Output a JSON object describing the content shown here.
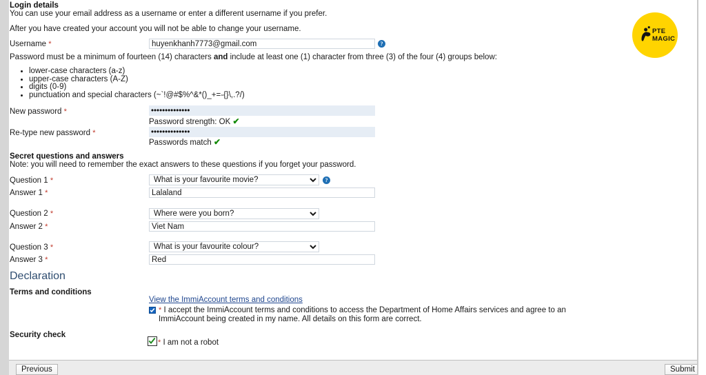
{
  "login_section": {
    "heading": "Login details",
    "intro_line1": "You can use your email address as a username or enter a different username if you prefer.",
    "intro_line2": "After you have created your account you will not be able to change your username.",
    "username_label": "Username",
    "username_value": "huyenkhanh7773@gmail.com",
    "username_help_icon": "help-icon",
    "password_rule_intro_a": "Password must be a minimum of fourteen (14) characters ",
    "password_rule_intro_bold": "and",
    "password_rule_intro_b": " include at least one (1) character from three (3) of the four (4) groups below:",
    "password_rules": [
      "lower-case characters (a-z)",
      "upper-case characters (A-Z)",
      "digits (0-9)",
      "punctuation and special characters (~`!@#$%^&*()_+=-{}\\,.?/)"
    ],
    "new_password_label": "New password",
    "new_password_value": "••••••••••••••",
    "password_strength_text": "Password strength: OK",
    "retype_password_label": "Re-type new password",
    "retype_password_value": "••••••••••••••",
    "passwords_match_text": "Passwords match",
    "tick_glyph": "✔"
  },
  "secret_section": {
    "heading": "Secret questions and answers",
    "note": "Note: you will need to remember the exact answers to these questions if you forget your password.",
    "help_icon": "help-icon",
    "items": [
      {
        "question_label": "Question 1",
        "question_value": "What is your favourite movie?",
        "answer_label": "Answer 1",
        "answer_value": "Lalaland"
      },
      {
        "question_label": "Question 2",
        "question_value": "Where were you born?",
        "answer_label": "Answer 2",
        "answer_value": "Viet Nam"
      },
      {
        "question_label": "Question 3",
        "question_value": "What is your favourite colour?",
        "answer_label": "Answer 3",
        "answer_value": "Red"
      }
    ]
  },
  "declaration_section": {
    "heading": "Declaration",
    "terms_label": "Terms and conditions",
    "terms_link": "View the ImmiAccount terms and conditions",
    "accept_text": "I accept the ImmiAccount terms and conditions to access the Department of Home Affairs services and agree to an ImmiAccount being created in my name. All details on this form are correct.",
    "accept_checked": true,
    "security_label": "Security check",
    "robot_text": "I am not a robot",
    "robot_checked": true
  },
  "footer": {
    "previous_label": "Previous",
    "submit_label": "Submit"
  },
  "logo": {
    "line1": "PTE",
    "line2": "MAGIC",
    "icon": "pte-magic-figure-icon",
    "color": "#FFD400"
  },
  "required_marker": "*"
}
